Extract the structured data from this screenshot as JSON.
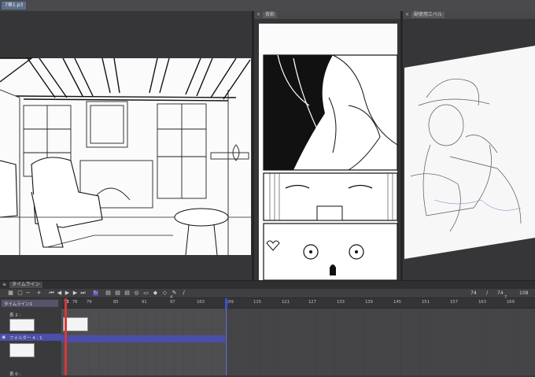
{
  "file_tab": "7章1.p3",
  "panels": {
    "center": {
      "label": "背影"
    },
    "right": {
      "label": "副使用エベル"
    }
  },
  "timeline": {
    "panel_label": "タイムライン",
    "track_name": "タイムライン1",
    "frame_counter": {
      "current": "74",
      "sep": "/",
      "total": "74",
      "end": "108"
    },
    "ruler_ticks": [
      "73",
      "76",
      "79",
      "85",
      "91",
      "97",
      "103",
      "109",
      "115",
      "121",
      "127",
      "133",
      "139",
      "145",
      "151",
      "157",
      "163",
      "169"
    ],
    "ruler_marker": "4",
    "ruler_tail": "7",
    "rows": [
      {
        "label": "表 2 :"
      },
      {
        "label": "フォルダー 4 : 1"
      },
      {
        "label": "表 0 :"
      }
    ],
    "colors": {
      "playhead": "#d23a3a",
      "endmark": "#3a4fd2",
      "highlight": "#4b4fa8"
    }
  }
}
